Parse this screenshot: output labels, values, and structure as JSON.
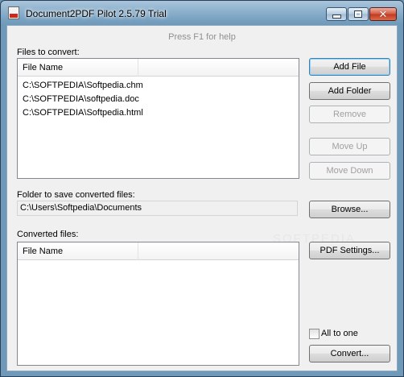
{
  "window": {
    "title": "Document2PDF Pilot 2.5.79 Trial"
  },
  "hint_text": "Press F1 for help",
  "files_section": {
    "label": "Files to convert:",
    "column_header": "File Name",
    "files": [
      "C:\\SOFTPEDIA\\Softpedia.chm",
      "C:\\SOFTPEDIA\\softpedia.doc",
      "C:\\SOFTPEDIA\\Softpedia.html"
    ]
  },
  "buttons": {
    "add_file": "Add File",
    "add_folder": "Add Folder",
    "remove": "Remove",
    "move_up": "Move Up",
    "move_down": "Move Down",
    "browse": "Browse...",
    "pdf_settings": "PDF Settings...",
    "convert": "Convert..."
  },
  "folder_section": {
    "label": "Folder to save converted files:",
    "path": "C:\\Users\\Softpedia\\Documents"
  },
  "converted_section": {
    "label": "Converted files:",
    "column_header": "File Name"
  },
  "all_to_one": {
    "label": "All to one",
    "checked": false
  },
  "watermark": "SOFTPEDIA"
}
